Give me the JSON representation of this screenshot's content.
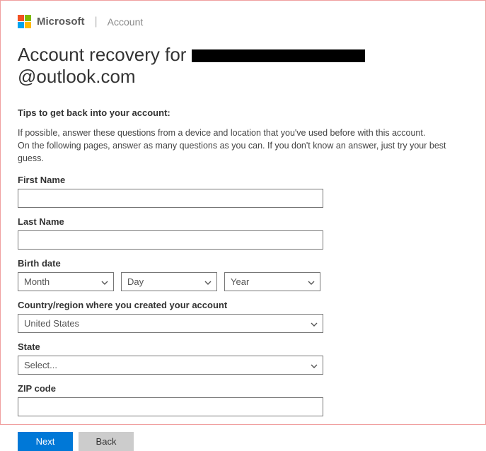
{
  "header": {
    "brand": "Microsoft",
    "section": "Account"
  },
  "title": {
    "prefix": "Account recovery for ",
    "redacted": true,
    "suffix": "@outlook.com"
  },
  "tips": {
    "heading": "Tips to get back into your account:",
    "line1": "If possible, answer these questions from a device and location that you've used before with this account.",
    "line2": "On the following pages, answer as many questions as you can. If you don't know an answer, just try your best guess."
  },
  "labels": {
    "first_name": "First Name",
    "last_name": "Last Name",
    "birth_date": "Birth date",
    "country": "Country/region where you created your account",
    "state": "State",
    "zip": "ZIP code"
  },
  "fields": {
    "first_name_value": "",
    "last_name_value": "",
    "birth_month": "Month",
    "birth_day": "Day",
    "birth_year": "Year",
    "country_value": "United States",
    "state_value": "Select...",
    "zip_value": ""
  },
  "buttons": {
    "next": "Next",
    "back": "Back"
  }
}
